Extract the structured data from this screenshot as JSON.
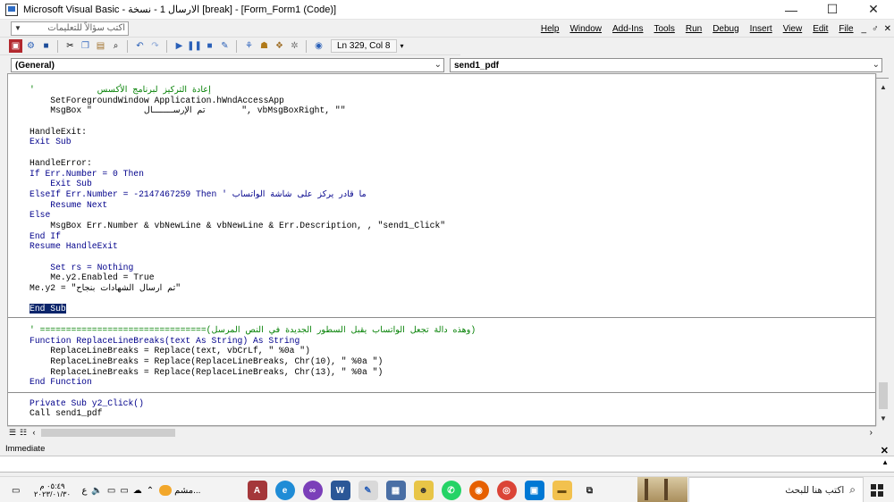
{
  "window": {
    "title": "Microsoft Visual Basic - الارسال 1 - نسخة [break] - [Form_Form1 (Code)]",
    "min_glyph": "—",
    "max_glyph": "☐",
    "close_glyph": "✕"
  },
  "menubar": {
    "help_placeholder": "اكتب سؤالاً للتعليمات",
    "items": [
      "Help",
      "Window",
      "Add-Ins",
      "Tools",
      "Run",
      "Debug",
      "Insert",
      "View",
      "Edit",
      "File"
    ],
    "mdi_controls": [
      "_",
      "♂",
      "✕"
    ]
  },
  "toolbar": {
    "position_text": "Ln 329, Col 8"
  },
  "combos": {
    "object": "(General)",
    "procedure": "send1_pdf"
  },
  "code": {
    "block1": [
      {
        "t": "'            إعادة التركيز لبرنامج الأكسس",
        "c": "cm"
      },
      {
        "t": "    SetForegroundWindow Application.hWndAccessApp",
        "c": ""
      },
      {
        "t": "    MsgBox \"          تم الإرســــــــال       \", vbMsgBoxRight, \"\"",
        "c": ""
      },
      {
        "t": "",
        "c": ""
      },
      {
        "t": "HandleExit:",
        "c": ""
      },
      {
        "t": "Exit Sub",
        "c": "kw"
      },
      {
        "t": "",
        "c": ""
      },
      {
        "t": "HandleError:",
        "c": ""
      },
      {
        "t": "If Err.Number = 0 Then",
        "c": "kw"
      },
      {
        "t": "    Exit Sub",
        "c": "kw"
      },
      {
        "t": "ElseIf Err.Number = -2147467259 Then ' ما قادر يركز على شاشة الواتساب",
        "c": "mix1"
      },
      {
        "t": "    Resume Next",
        "c": "kw"
      },
      {
        "t": "Else",
        "c": "kw"
      },
      {
        "t": "    MsgBox Err.Number & vbNewLine & vbNewLine & Err.Description, , \"send1_Click\"",
        "c": ""
      },
      {
        "t": "End If",
        "c": "kw"
      },
      {
        "t": "Resume HandleExit",
        "c": "kw"
      },
      {
        "t": "",
        "c": ""
      },
      {
        "t": "    Set rs = Nothing",
        "c": "kw"
      },
      {
        "t": "    Me.y2.Enabled = True",
        "c": ""
      },
      {
        "t": "Me.y2 = \"تم ارسال الشهادات بنجاح\"",
        "c": ""
      },
      {
        "t": "",
        "c": ""
      },
      {
        "t": "End Sub",
        "c": "sel"
      }
    ],
    "block2": [
      {
        "t": "' ================================(وهذه دالة تجعل الواتساب يقبل السطور الجديدة في النص المرسل)",
        "c": "cm"
      },
      {
        "t": "Function ReplaceLineBreaks(text As String) As String",
        "c": "kw"
      },
      {
        "t": "    ReplaceLineBreaks = Replace(text, vbCrLf, \" %0a \")",
        "c": ""
      },
      {
        "t": "    ReplaceLineBreaks = Replace(ReplaceLineBreaks, Chr(10), \" %0a \")",
        "c": ""
      },
      {
        "t": "    ReplaceLineBreaks = Replace(ReplaceLineBreaks, Chr(13), \" %0a \")",
        "c": ""
      },
      {
        "t": "End Function",
        "c": "kw"
      }
    ],
    "block3": [
      {
        "t": "Private Sub y2_Click()",
        "c": "kw"
      },
      {
        "t": "Call send1_pdf",
        "c": ""
      }
    ]
  },
  "immediate": {
    "title": "Immediate",
    "close": "✕"
  },
  "taskbar": {
    "clock_time": "٠٥:٤٩ م",
    "clock_date": "٢٠٢٣/٠١/٣٠",
    "lang": "ع",
    "weather_text": "مشم...",
    "search_placeholder": "اكتب هنا للبحث"
  }
}
